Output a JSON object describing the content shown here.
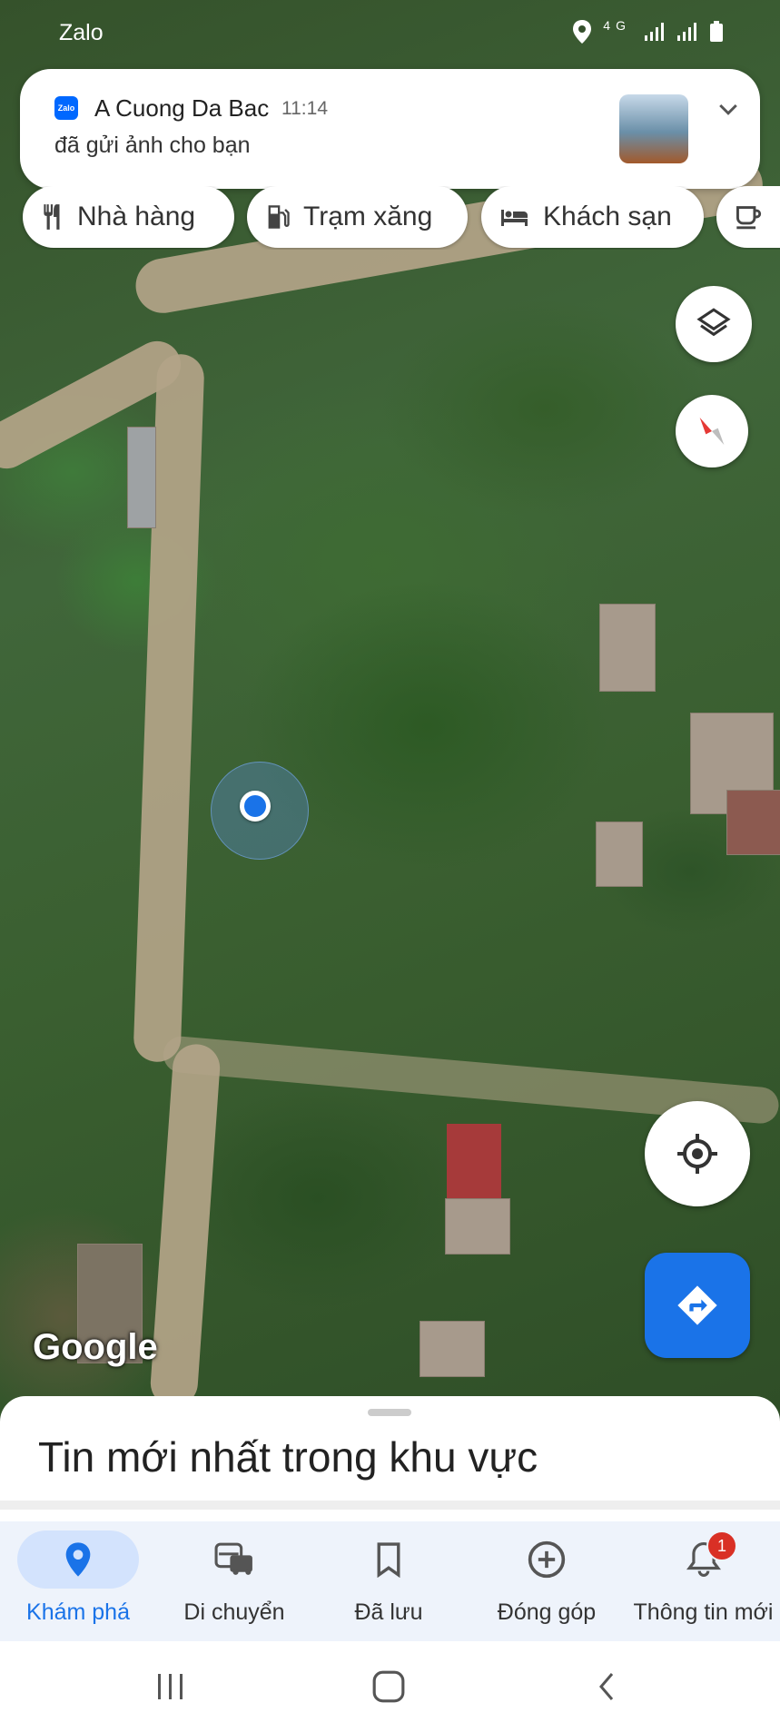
{
  "status_bar": {
    "app_label": "Zalo",
    "network": "4G"
  },
  "notification": {
    "app_icon_label": "Zalo",
    "sender": "A Cuong Da Bac",
    "time": "11:14",
    "message": "đã gửi ảnh cho bạn"
  },
  "chips": [
    {
      "label": "Nhà hàng",
      "icon": "restaurant-icon"
    },
    {
      "label": "Trạm xăng",
      "icon": "gas-station-icon"
    },
    {
      "label": "Khách sạn",
      "icon": "hotel-icon"
    },
    {
      "label": "",
      "icon": "coffee-icon"
    }
  ],
  "map": {
    "attribution": "Google"
  },
  "sheet": {
    "title": "Tin mới nhất trong khu vực"
  },
  "bottom_nav": [
    {
      "label": "Khám phá",
      "icon": "explore-pin-icon",
      "active": true
    },
    {
      "label": "Di chuyển",
      "icon": "commute-icon"
    },
    {
      "label": "Đã lưu",
      "icon": "saved-bookmark-icon"
    },
    {
      "label": "Đóng góp",
      "icon": "contribute-icon"
    },
    {
      "label": "Thông tin mới",
      "icon": "updates-bell-icon",
      "badge": "1"
    }
  ],
  "colors": {
    "accent": "#1a73e8",
    "badge": "#d93025"
  }
}
